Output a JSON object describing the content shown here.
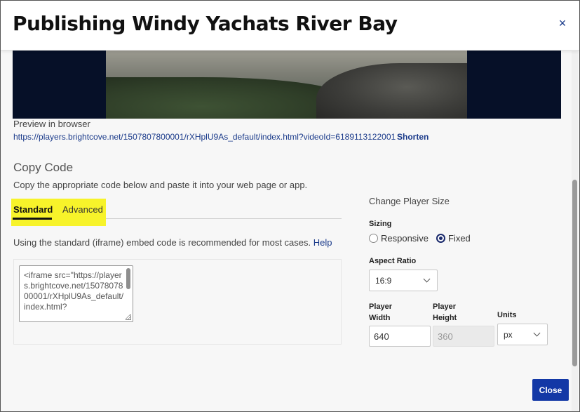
{
  "modal": {
    "title": "Publishing Windy Yachats River Bay",
    "close_icon": "×"
  },
  "preview": {
    "label": "Preview in browser",
    "url": "https://players.brightcove.net/1507807800001/rXHplU9As_default/index.html?videoId=6189113122001",
    "shorten_label": "Shorten"
  },
  "copy_code": {
    "heading": "Copy Code",
    "description": "Copy the appropriate code below and paste it into your web page or app.",
    "tabs": [
      {
        "label": "Standard",
        "active": true
      },
      {
        "label": "Advanced",
        "active": false
      }
    ],
    "note": "Using the standard (iframe) embed code is recommended for most cases.",
    "help_label": "Help",
    "code_value": "<iframe src=\"https://players.brightcove.net/1507807800001/rXHplU9As_default/index.html?"
  },
  "player_size": {
    "heading": "Change Player Size",
    "sizing_label": "Sizing",
    "sizing_options": [
      {
        "label": "Responsive",
        "checked": false
      },
      {
        "label": "Fixed",
        "checked": true
      }
    ],
    "aspect_label": "Aspect Ratio",
    "aspect_value": "16:9",
    "width_label": "Player Width",
    "width_value": "640",
    "height_label": "Player Height",
    "height_value": "360",
    "units_label": "Units",
    "units_value": "px"
  },
  "footer": {
    "close_label": "Close"
  },
  "colors": {
    "accent": "#1338a6",
    "link": "#1a3a8a",
    "highlight": "#f7f32a",
    "video_bg": "#061028"
  }
}
